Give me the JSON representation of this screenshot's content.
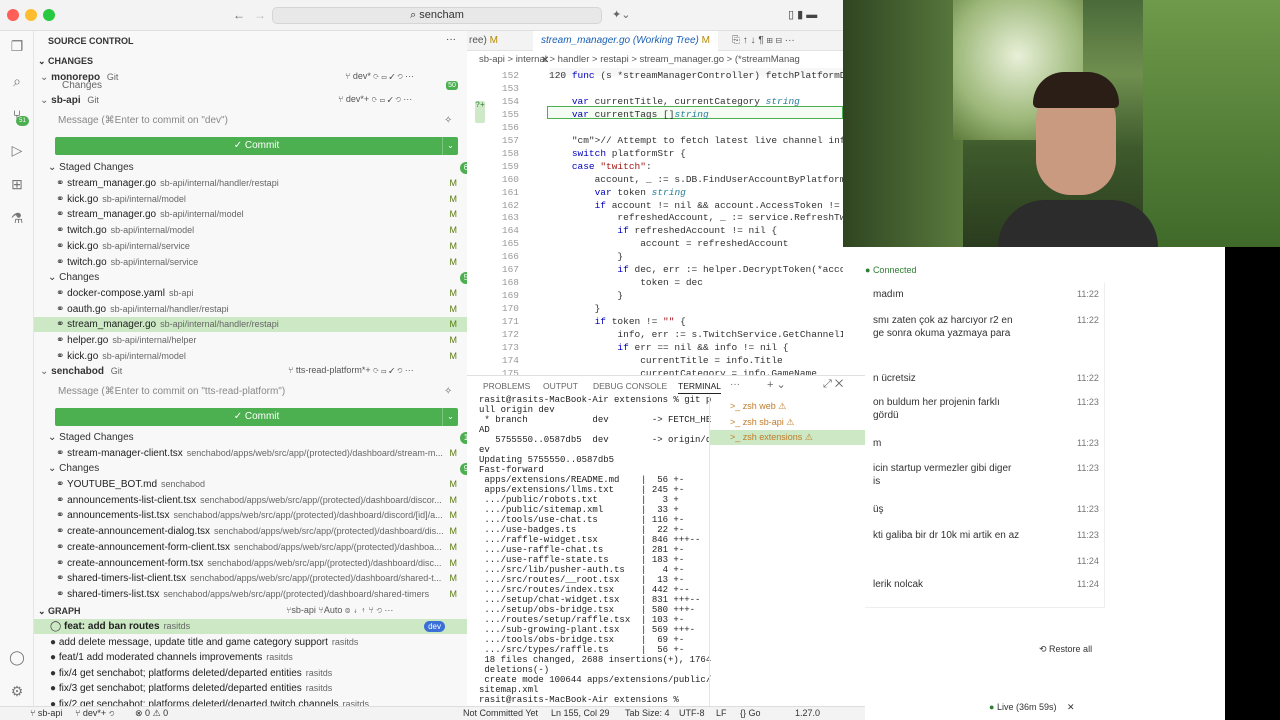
{
  "titlebar": {
    "search": "sencham"
  },
  "source_control": {
    "title": "SOURCE CONTROL",
    "changes_header": "CHANGES",
    "monorepo": {
      "name": "monorepo",
      "type": "Git",
      "branch": "dev*"
    },
    "monorepo_sub": "Changes",
    "monorepo_badge": "50",
    "sbapi": {
      "name": "sb-api",
      "type": "Git",
      "branch": "dev*+",
      "message_placeholder": "Message (⌘Enter to commit on \"dev\")",
      "commit": "✓ Commit"
    },
    "sbapi_staged": {
      "label": "Staged Changes",
      "count": "6",
      "items": [
        {
          "name": "stream_manager.go",
          "path": "sb-api/internal/handler/restapi",
          "status": "M"
        },
        {
          "name": "kick.go",
          "path": "sb-api/internal/model",
          "status": "M"
        },
        {
          "name": "stream_manager.go",
          "path": "sb-api/internal/model",
          "status": "M"
        },
        {
          "name": "twitch.go",
          "path": "sb-api/internal/model",
          "status": "M"
        },
        {
          "name": "kick.go",
          "path": "sb-api/internal/service",
          "status": "M"
        },
        {
          "name": "twitch.go",
          "path": "sb-api/internal/service",
          "status": "M"
        }
      ]
    },
    "sbapi_changes": {
      "label": "Changes",
      "count": "5",
      "items": [
        {
          "name": "docker-compose.yaml",
          "path": "sb-api",
          "status": "M"
        },
        {
          "name": "oauth.go",
          "path": "sb-api/internal/handler/restapi",
          "status": "M"
        },
        {
          "name": "stream_manager.go",
          "path": "sb-api/internal/handler/restapi",
          "status": "M"
        },
        {
          "name": "helper.go",
          "path": "sb-api/internal/helper",
          "status": "M"
        },
        {
          "name": "kick.go",
          "path": "sb-api/internal/model",
          "status": "M"
        }
      ]
    },
    "senchabod": {
      "name": "senchabod",
      "type": "Git",
      "branch": "tts-read-platform*+",
      "message_placeholder": "Message (⌘Enter to commit on \"tts-read-platform\")",
      "commit": "✓ Commit"
    },
    "senchabod_staged": {
      "label": "Staged Changes",
      "count": "1",
      "items": [
        {
          "name": "stream-manager-client.tsx",
          "path": "senchabod/apps/web/src/app/(protected)/dashboard/stream-m...",
          "status": "M"
        }
      ]
    },
    "senchabod_changes": {
      "label": "Changes",
      "count": "9",
      "items": [
        {
          "name": "YOUTUBE_BOT.md",
          "path": "senchabod",
          "status": "M"
        },
        {
          "name": "announcements-list-client.tsx",
          "path": "senchabod/apps/web/src/app/(protected)/dashboard/discor...",
          "status": "M"
        },
        {
          "name": "announcements-list.tsx",
          "path": "senchabod/apps/web/src/app/(protected)/dashboard/discord/[id]/a...",
          "status": "M"
        },
        {
          "name": "create-announcement-dialog.tsx",
          "path": "senchabod/apps/web/src/app/(protected)/dashboard/dis...",
          "status": "M"
        },
        {
          "name": "create-announcement-form-client.tsx",
          "path": "senchabod/apps/web/src/app/(protected)/dashboa...",
          "status": "M"
        },
        {
          "name": "create-announcement-form.tsx",
          "path": "senchabod/apps/web/src/app/(protected)/dashboard/disc...",
          "status": "M"
        },
        {
          "name": "shared-timers-list-client.tsx",
          "path": "senchabod/apps/web/src/app/(protected)/dashboard/shared-t...",
          "status": "M"
        },
        {
          "name": "shared-timers-list.tsx",
          "path": "senchabod/apps/web/src/app/(protected)/dashboard/shared-timers",
          "status": "M"
        }
      ]
    },
    "graph": {
      "title": "GRAPH",
      "repo": "sb-api",
      "mode": "Auto",
      "commits": [
        {
          "msg": "feat: add ban routes",
          "author": "rasitds",
          "tag": "dev"
        },
        {
          "msg": "add delete message, update title and game category support",
          "author": "rasitds"
        },
        {
          "msg": "feat/1 add moderated channels improvements",
          "author": "rasitds"
        },
        {
          "msg": "fix/4 get senchabot; platforms deleted/departed entities",
          "author": "rasitds"
        },
        {
          "msg": "fix/3 get senchabot; platforms deleted/departed entities",
          "author": "rasitds"
        },
        {
          "msg": "fix/2 get senchabot; platforms deleted/departed twitch channels",
          "author": "rasitds"
        }
      ]
    }
  },
  "editor": {
    "tab_prev": "ree)",
    "tab_prev_status": "M",
    "tab_active": "stream_manager.go (Working Tree)",
    "tab_active_status": "M",
    "breadcrumb": "sb-api  >  internal  >  handler  >  restapi  >  stream_manager.go  >  (*streamManag",
    "lines": [
      {
        "n": "152",
        "code": "120 func (s *streamManagerController) fetchPlatformData(c *"
      },
      {
        "n": "153",
        "code": ""
      },
      {
        "n": "154",
        "code": "    var currentTitle, currentCategory string"
      },
      {
        "n": "155",
        "code": "    var currentTags []string"
      },
      {
        "n": "156",
        "code": ""
      },
      {
        "n": "157",
        "code": "    // Attempt to fetch latest live channel information"
      },
      {
        "n": "158",
        "code": "    switch platformStr {"
      },
      {
        "n": "159",
        "code": "    case \"twitch\":"
      },
      {
        "n": "160",
        "code": "        account, _ := s.DB.FindUserAccountByPlatform(c.Co"
      },
      {
        "n": "161",
        "code": "        var token string"
      },
      {
        "n": "162",
        "code": "        if account != nil && account.AccessToken != nil"
      },
      {
        "n": "163",
        "code": "            refreshedAccount, _ := service.RefreshTwitch"
      },
      {
        "n": "164",
        "code": "            if refreshedAccount != nil {"
      },
      {
        "n": "165",
        "code": "                account = refreshedAccount"
      },
      {
        "n": "166",
        "code": "            }"
      },
      {
        "n": "167",
        "code": "            if dec, err := helper.DecryptToken(*account.A"
      },
      {
        "n": "168",
        "code": "                token = dec"
      },
      {
        "n": "169",
        "code": "            }"
      },
      {
        "n": "170",
        "code": "        }"
      },
      {
        "n": "171",
        "code": "        if token != \"\" {"
      },
      {
        "n": "172",
        "code": "            info, err := s.TwitchService.GetChannelInform"
      },
      {
        "n": "173",
        "code": "            if err == nil && info != nil {"
      },
      {
        "n": "174",
        "code": "                currentTitle = info.Title"
      },
      {
        "n": "175",
        "code": "                currentCategory = info.GameName"
      }
    ]
  },
  "panel": {
    "tabs": [
      "PROBLEMS",
      "OUTPUT",
      "DEBUG CONSOLE",
      "TERMINAL"
    ],
    "terminal_lines": [
      "rasit@rasits-MacBook-Air extensions % git p",
      "ull origin dev",
      " * branch            dev        -> FETCH_HE",
      "AD",
      "   5755550..0587db5  dev        -> origin/d",
      "ev",
      "Updating 5755550..0587db5",
      "Fast-forward",
      " apps/extensions/README.md    |  56 +-",
      " apps/extensions/llms.txt     | 245 +-",
      " .../public/robots.txt        |   3 +",
      " .../public/sitemap.xml       |  33 +",
      " .../tools/use-chat.ts        | 116 +-",
      " .../use-badges.ts            |  22 +-",
      " .../raffle-widget.tsx        | 846 +++--",
      " .../use-raffle-chat.ts       | 281 +-",
      " .../use-raffle-state.ts      | 183 +-",
      " .../src/lib/pusher-auth.ts   |   4 +-",
      " .../src/routes/__root.tsx    |  13 +-",
      " .../src/routes/index.tsx     | 442 +--",
      " .../setup/chat-widget.tsx    | 831 +++--",
      " .../setup/obs-bridge.tsx     | 580 +++-",
      " .../routes/setup/raffle.tsx  | 103 +-",
      " .../sub-growing-plant.tsx    | 569 +++-",
      " .../tools/obs-bridge.tsx     |  69 +-",
      " .../src/types/raffle.ts      |  56 +-",
      " 18 files changed, 2688 insertions(+), 1764",
      " deletions(-)",
      " create mode 100644 apps/extensions/public/",
      "sitemap.xml",
      "rasit@rasits-MacBook-Air extensions % "
    ],
    "terminals": [
      {
        "name": "zsh",
        "label": "web"
      },
      {
        "name": "zsh",
        "label": "sb-api"
      },
      {
        "name": "zsh",
        "label": "extensions"
      }
    ]
  },
  "statusbar": {
    "repo": "sb-api",
    "branch": "dev*+",
    "problems": "0",
    "warnings": "0",
    "commit_status": "Not Committed Yet",
    "position": "Ln 155, Col 29",
    "tab_size": "Tab Size: 4",
    "encoding": "UTF-8",
    "eol": "LF",
    "lang": "Go",
    "version": "1.27.0"
  },
  "right_app": {
    "status": "Connected",
    "messages": [
      {
        "text": "madım",
        "time": "11:22"
      },
      {
        "text": "smı zaten çok az harcıyor r2 en\nge sonra okuma yazmaya para",
        "time": "11:22"
      },
      {
        "text": "n ücretsiz",
        "time": "11:22"
      },
      {
        "text": "on buldum her projenin farklı\ngördü",
        "time": "11:23"
      },
      {
        "text": "m",
        "time": "11:23"
      },
      {
        "text": "icin startup vermezler gibi diger\nis",
        "time": "11:23"
      },
      {
        "text": "üş",
        "time": "11:23"
      },
      {
        "text": "kti galiba bir dr 10k mi artik en az",
        "time": "11:23"
      },
      {
        "text": "",
        "time": "11:24"
      },
      {
        "text": "lerik nolcak",
        "time": "11:24"
      }
    ],
    "restore": "Restore all",
    "live": "Live",
    "live_time": "(36m 59s)"
  },
  "colors": {
    "accent": "#4caf50",
    "selected": "#cce8c4"
  }
}
